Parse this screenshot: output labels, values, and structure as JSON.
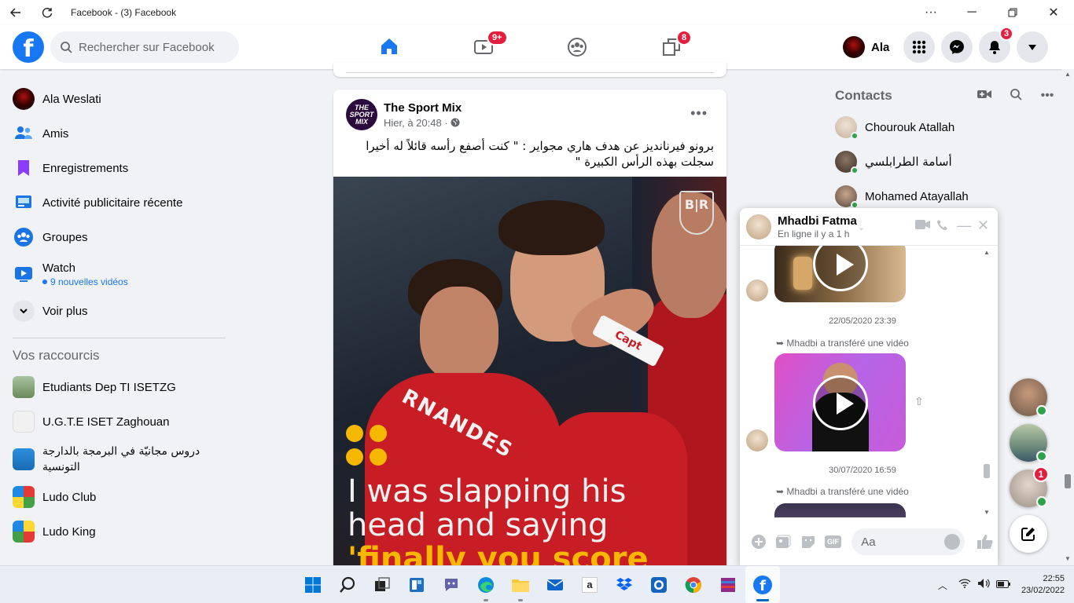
{
  "window": {
    "title": "Facebook - (3) Facebook"
  },
  "header": {
    "search_placeholder": "Rechercher sur Facebook",
    "watch_badge": "9+",
    "gaming_badge": "8",
    "profile_name": "Ala",
    "notifications_badge": "3",
    "brand_color": "#1877f2"
  },
  "sidebar": {
    "items": [
      {
        "label": "Ala Weslati",
        "icon": "profile-avatar"
      },
      {
        "label": "Amis",
        "icon": "friends-icon"
      },
      {
        "label": "Enregistrements",
        "icon": "bookmark-icon"
      },
      {
        "label": "Activité publicitaire récente",
        "icon": "ad-activity-icon"
      },
      {
        "label": "Groupes",
        "icon": "groups-icon"
      },
      {
        "label": "Watch",
        "sub": "9 nouvelles vidéos",
        "icon": "watch-icon"
      },
      {
        "label": "Voir plus",
        "icon": "chevron-down-icon"
      }
    ],
    "shortcuts_title": "Vos raccourcis",
    "shortcuts": [
      {
        "label": "Etudiants Dep TI ISETZG"
      },
      {
        "label": "U.G.T.E ISET Zaghouan"
      },
      {
        "label": "دروس مجانيّة في البرمجة بالدارجة التونسية"
      },
      {
        "label": "Ludo Club"
      },
      {
        "label": "Ludo King"
      }
    ]
  },
  "post": {
    "page_name": "The Sport Mix",
    "page_logo_text": "THE SPORT MIX",
    "time": "Hier, à 20:48 ·",
    "text": "برونو فيرنانديز عن هدف هاري مجواير : \" كنت أصفع رأسه قائلاً له أخيرا سجلت بهذه الرأس الكبيرة \"",
    "image": {
      "logo": "B|R",
      "shirt_text": "RNANDES",
      "quote_line1": "I was slapping his",
      "quote_line2": "head and saying",
      "quote_line3": "'finally you score with"
    }
  },
  "contacts": {
    "title": "Contacts",
    "list": [
      {
        "name": "Chourouk Atallah"
      },
      {
        "name": "أسامة الطرابلسي"
      },
      {
        "name": "Mohamed Atayallah"
      }
    ]
  },
  "chat": {
    "name": "Mhadbi Fatma",
    "status": "En ligne il y a 1 h",
    "timestamp1": "22/05/2020 23:39",
    "forward1": "Mhadbi a transféré une vidéo",
    "timestamp2": "30/07/2020 16:59",
    "forward2": "Mhadbi a transféré une vidéo",
    "input_placeholder": "Aa",
    "gif_label": "GIF"
  },
  "floating_chats": {
    "third_badge": "1"
  },
  "taskbar": {
    "time": "22:55",
    "date": "23/02/2022"
  }
}
